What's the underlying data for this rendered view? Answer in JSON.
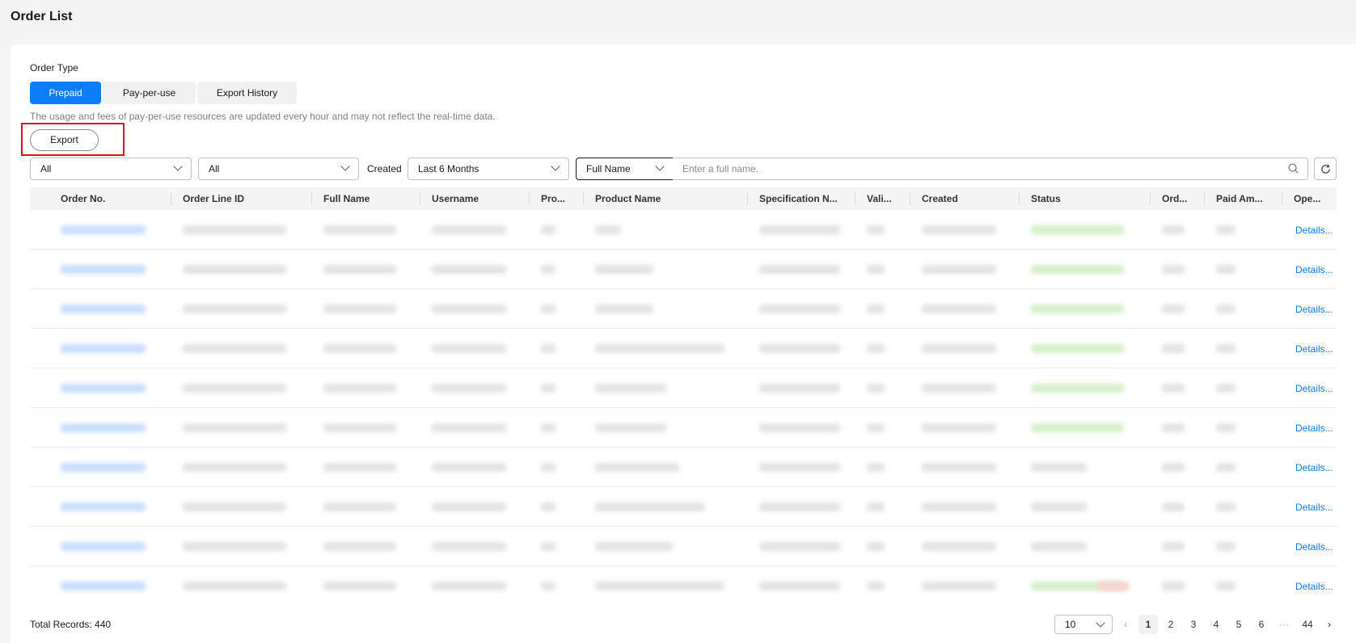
{
  "page": {
    "title": "Order List"
  },
  "order_type": {
    "label": "Order Type",
    "tabs": [
      {
        "label": "Prepaid",
        "active": true
      },
      {
        "label": "Pay-per-use",
        "active": false
      },
      {
        "label": "Export History",
        "active": false
      }
    ],
    "notice": "The usage and fees of pay-per-use resources are updated every hour and may not reflect the real-time data."
  },
  "toolbar": {
    "export_label": "Export"
  },
  "filters": {
    "filter1_value": "All",
    "filter2_value": "All",
    "created_label": "Created",
    "created_value": "Last 6 Months",
    "search_field_value": "Full Name",
    "search_placeholder": "Enter a full name."
  },
  "table": {
    "columns": [
      "Order No.",
      "Order Line ID",
      "Full Name",
      "Username",
      "Pro...",
      "Product Name",
      "Specification N...",
      "Vali...",
      "Created",
      "Status",
      "Ord...",
      "Paid Am...",
      "Ope..."
    ],
    "action_label": "Details...",
    "row_count": 10
  },
  "footer": {
    "total_records": "Total Records: 440",
    "page_size": "10",
    "pages": [
      "1",
      "2",
      "3",
      "4",
      "5",
      "6",
      "···",
      "44"
    ],
    "current_page": "1"
  },
  "colors": {
    "primary": "#0d7cf8",
    "highlight": "#e0101a"
  }
}
